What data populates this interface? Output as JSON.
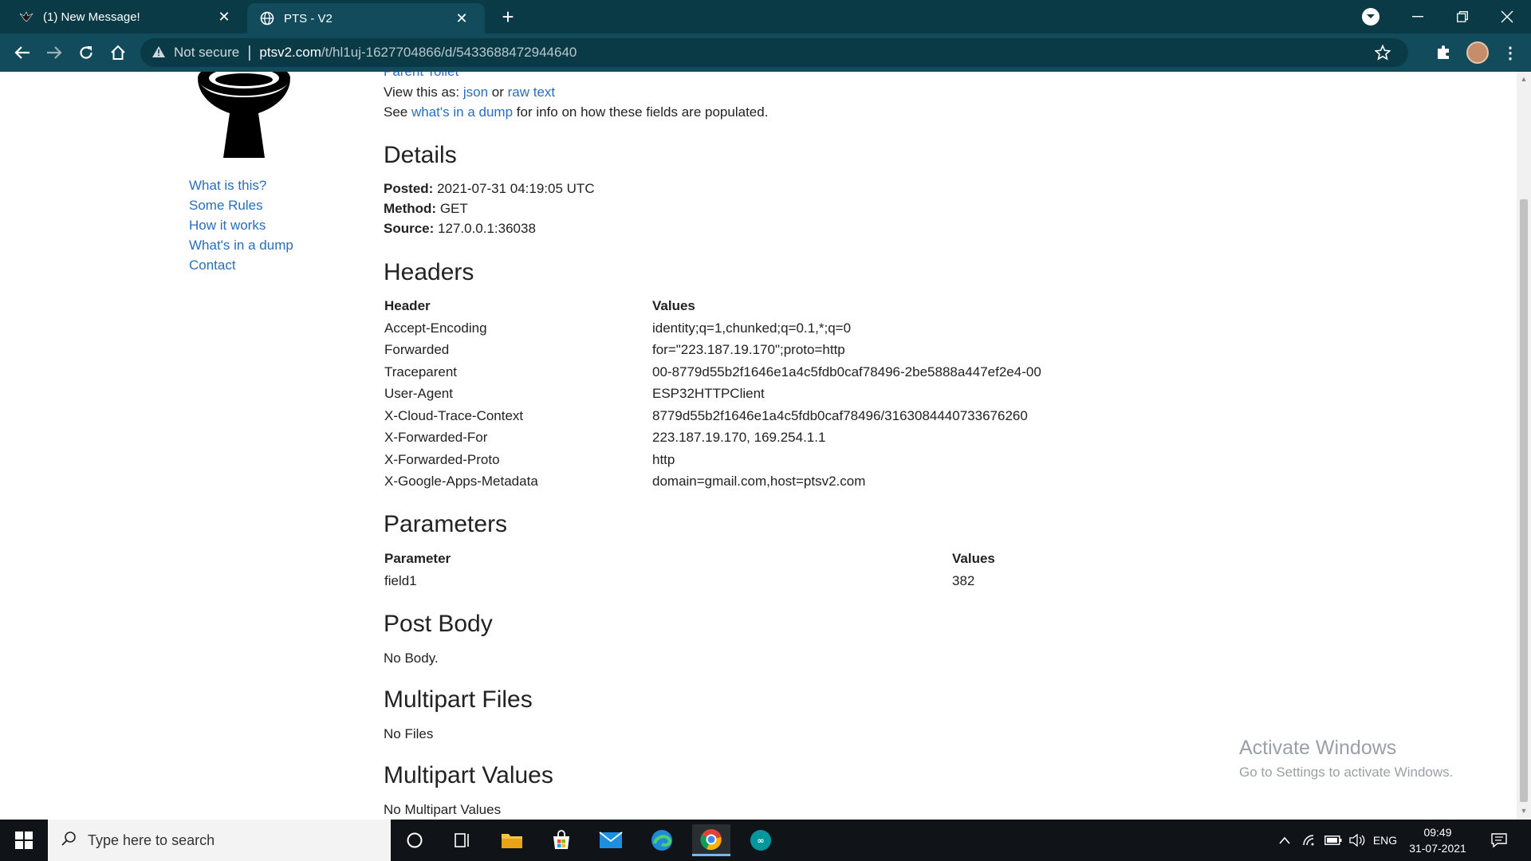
{
  "browser": {
    "tabs": [
      {
        "title": "(1) New Message!",
        "icon": "bird-favicon-icon"
      },
      {
        "title": "PTS - V2",
        "icon": "globe-icon"
      }
    ],
    "omnibox": {
      "security_label": "Not secure",
      "url_host": "ptsv2.com",
      "url_path": "/t/hl1uj-1627704866/d/5433688472944640"
    }
  },
  "sidebar": {
    "links": [
      "What is this?",
      "Some Rules",
      "How it works",
      "What's in a dump",
      "Contact"
    ]
  },
  "top": {
    "parent_link": "Parent Toilet",
    "view_as_prefix": "View this as:",
    "json_link": "json",
    "or_text": "or",
    "raw_link": "raw text",
    "see_prefix": "See",
    "dump_link": "what's in a dump",
    "see_suffix": "for info on how these fields are populated."
  },
  "details": {
    "title": "Details",
    "posted_label": "Posted:",
    "posted_value": "2021-07-31 04:19:05 UTC",
    "method_label": "Method:",
    "method_value": "GET",
    "source_label": "Source:",
    "source_value": "127.0.0.1:36038"
  },
  "headers": {
    "title": "Headers",
    "col_header": "Header",
    "col_values": "Values",
    "rows": [
      {
        "name": "Accept-Encoding",
        "value": "identity;q=1,chunked;q=0.1,*;q=0"
      },
      {
        "name": "Forwarded",
        "value": "for=\"223.187.19.170\";proto=http"
      },
      {
        "name": "Traceparent",
        "value": "00-8779d55b2f1646e1a4c5fdb0caf78496-2be5888a447ef2e4-00"
      },
      {
        "name": "User-Agent",
        "value": "ESP32HTTPClient"
      },
      {
        "name": "X-Cloud-Trace-Context",
        "value": "8779d55b2f1646e1a4c5fdb0caf78496/3163084440733676260"
      },
      {
        "name": "X-Forwarded-For",
        "value": "223.187.19.170, 169.254.1.1"
      },
      {
        "name": "X-Forwarded-Proto",
        "value": "http"
      },
      {
        "name": "X-Google-Apps-Metadata",
        "value": "domain=gmail.com,host=ptsv2.com"
      }
    ]
  },
  "parameters": {
    "title": "Parameters",
    "col_param": "Parameter",
    "col_values": "Values",
    "rows": [
      {
        "name": "field1",
        "value": "382"
      }
    ]
  },
  "post_body": {
    "title": "Post Body",
    "text": "No Body."
  },
  "multipart_files": {
    "title": "Multipart Files",
    "text": "No Files"
  },
  "multipart_values": {
    "title": "Multipart Values",
    "text": "No Multipart Values"
  },
  "watermark": {
    "line1": "Activate Windows",
    "line2": "Go to Settings to activate Windows."
  },
  "taskbar": {
    "search_placeholder": "Type here to search",
    "language": "ENG",
    "time": "09:49",
    "date": "31-07-2021"
  },
  "colors": {
    "link": "#2a6ebb",
    "chrome_tab_bar": "#0b3a47",
    "chrome_toolbar": "#124b5c"
  }
}
